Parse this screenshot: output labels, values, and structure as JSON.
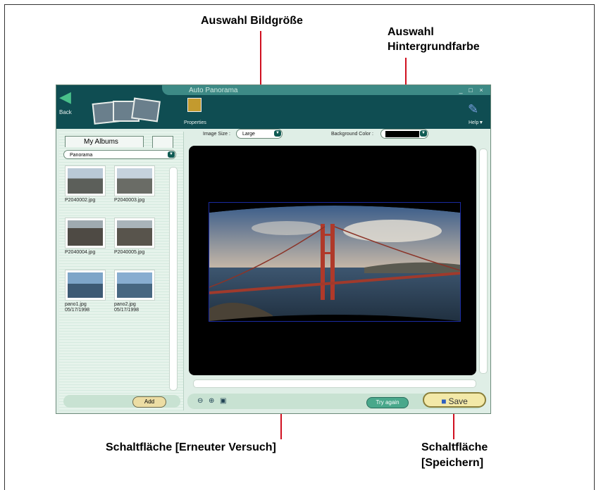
{
  "callouts": {
    "image_size": "Auswahl Bildgröße",
    "bg_color_line1": "Auswahl",
    "bg_color_line2": "Hintergrundfarbe",
    "try_again": "Schaltfläche [Erneuter Versuch]",
    "save_line1": "Schaltfläche",
    "save_line2": "[Speichern]"
  },
  "window": {
    "title": "Auto Panorama",
    "back_label": "Back",
    "properties_label": "Properties",
    "help_label": "Help▼",
    "controls": [
      "_",
      "□",
      "×"
    ]
  },
  "sidebar": {
    "tab_albums": "My Albums",
    "album_selected": "Panorama",
    "items": [
      {
        "label": "P2040002.jpg"
      },
      {
        "label": "P2040003.jpg"
      },
      {
        "label": "P2040004.jpg"
      },
      {
        "label": "P2040005.jpg"
      },
      {
        "label": "pano1.jpg\n05/17/1998"
      },
      {
        "label": "pano2.jpg\n05/17/1998"
      }
    ],
    "add_label": "Add"
  },
  "toolbar": {
    "image_size_label": "Image Size :",
    "image_size_value": "Large",
    "bg_color_label": "Background Color :",
    "bg_color_value": "#000000"
  },
  "bottom": {
    "try_again_label": "Try again",
    "save_label": "Save"
  }
}
